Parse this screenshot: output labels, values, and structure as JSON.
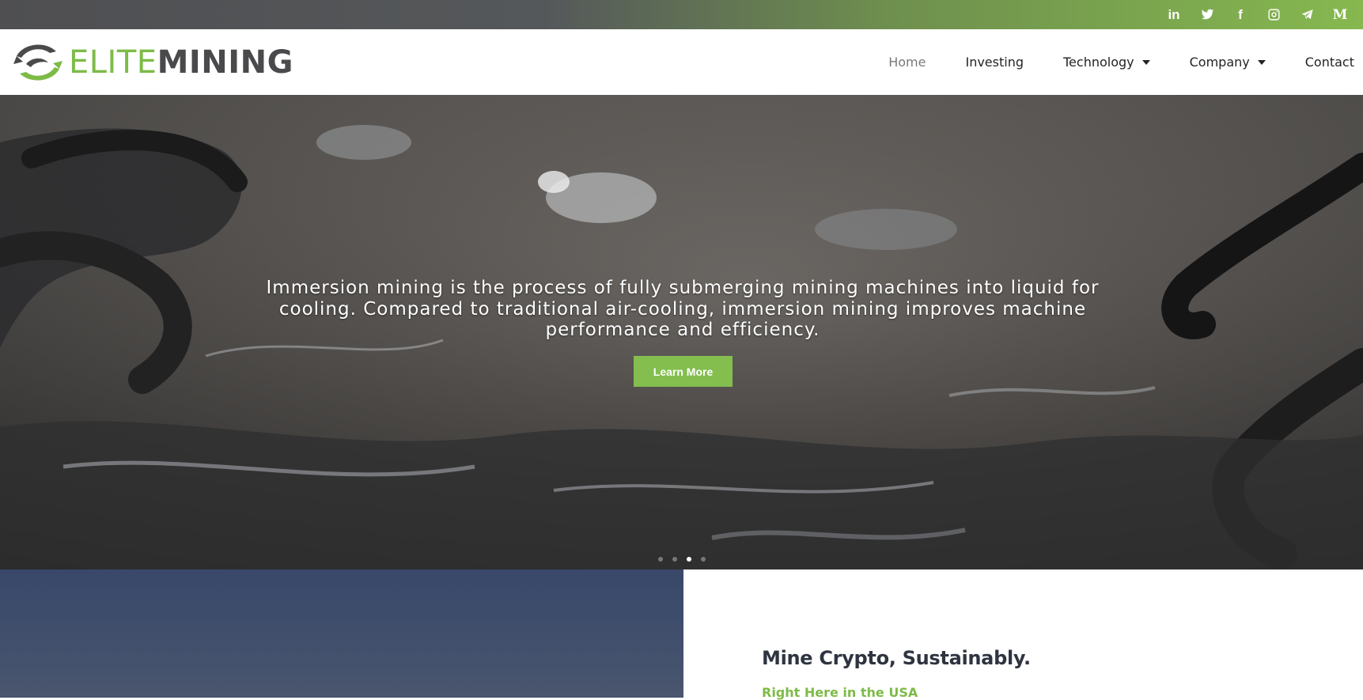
{
  "topbar": {
    "socials": [
      {
        "name": "linkedin-icon",
        "glyph": "in"
      },
      {
        "name": "twitter-icon"
      },
      {
        "name": "facebook-icon",
        "glyph": "f"
      },
      {
        "name": "instagram-icon"
      },
      {
        "name": "telegram-icon"
      },
      {
        "name": "medium-icon",
        "glyph": "M"
      }
    ]
  },
  "header": {
    "logo": {
      "part1": "ELITE",
      "part2": "MINING"
    },
    "nav": [
      {
        "label": "Home"
      },
      {
        "label": "Investing"
      },
      {
        "label": "Technology"
      },
      {
        "label": "Company"
      },
      {
        "label": "Contact"
      }
    ]
  },
  "hero": {
    "text": "Immersion mining is the process of fully submerging mining machines into liquid for cooling. Compared to traditional air-cooling, immersion mining improves machine performance and efficiency.",
    "button": "Learn More",
    "slide_count": 4,
    "active_slide": 3
  },
  "section": {
    "title": "Mine Crypto, Sustainably.",
    "subtitle": "Right Here in the USA"
  },
  "colors": {
    "accent": "#83be4e",
    "dark_text": "#2e3440",
    "logo_gray": "#4a4a4c"
  }
}
